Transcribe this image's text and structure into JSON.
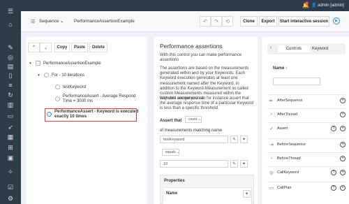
{
  "header": {
    "notification_count": "2",
    "user_label": "admin [admin]"
  },
  "toolbar": {
    "type_select": "Sequence",
    "sequence_name": "PerformanceAssertionExample",
    "clone_label": "Clone",
    "export_label": "Export",
    "interactive_label": "Start interactive session"
  },
  "tree_toolbar": {
    "copy_label": "Copy",
    "paste_label": "Paste",
    "delete_label": "Delete"
  },
  "tree": {
    "root": "PerformanceAssertionExample",
    "for_loop": "For - 10 iterations",
    "keyword": "testKeyword",
    "assert_avg_line1": "PerformanceAssert - Average Respond",
    "assert_avg_line2": "Time = 3000 ms",
    "assert_exec_line1": "PerformanceAssert - Keyword is executed",
    "assert_exec_line2": "exactly 10 times"
  },
  "doc": {
    "title": "Performance assertions",
    "intro": "With this control you can make performance assertions",
    "body": "The assertions are based on the measurements generated within and by your Keywords. Each Keyword execution generates at least one measurement named after the Keyword. In addition to the Keyword-Measurement so called custom Measurements measured within the Keyword are generated.",
    "body2": "With this control you can for instance assert that the average response time of a particular Keyword is less than a specific threshold.",
    "assert_label": "Assert that",
    "assert_select": "count",
    "measurements_label": "of measurements matching name",
    "name_value": "testKeyword",
    "operator_select": "equals",
    "expected_value": "10",
    "properties_title": "Properties",
    "name_header": "Name"
  },
  "palette": {
    "tabs": [
      "Controls",
      "Keyword"
    ],
    "name_header": "Name",
    "items": [
      {
        "label": "AfterSequence",
        "icon": "arrow-left-icon"
      },
      {
        "label": "AfterThread",
        "icon": "chevron-right-icon"
      },
      {
        "label": "Assert",
        "icon": "check-icon"
      },
      {
        "label": "BeforeSequence",
        "icon": "arrow-right-icon"
      },
      {
        "label": "BeforeThread",
        "icon": "chevron-right-icon"
      },
      {
        "label": "CallKeyword",
        "icon": "target-icon"
      },
      {
        "label": "CallPlan",
        "icon": "plan-icon"
      }
    ]
  },
  "colors": {
    "sidebar_bg": "#2f3b49",
    "accent": "#2d8fd5",
    "selection_border": "#d93c3c"
  }
}
